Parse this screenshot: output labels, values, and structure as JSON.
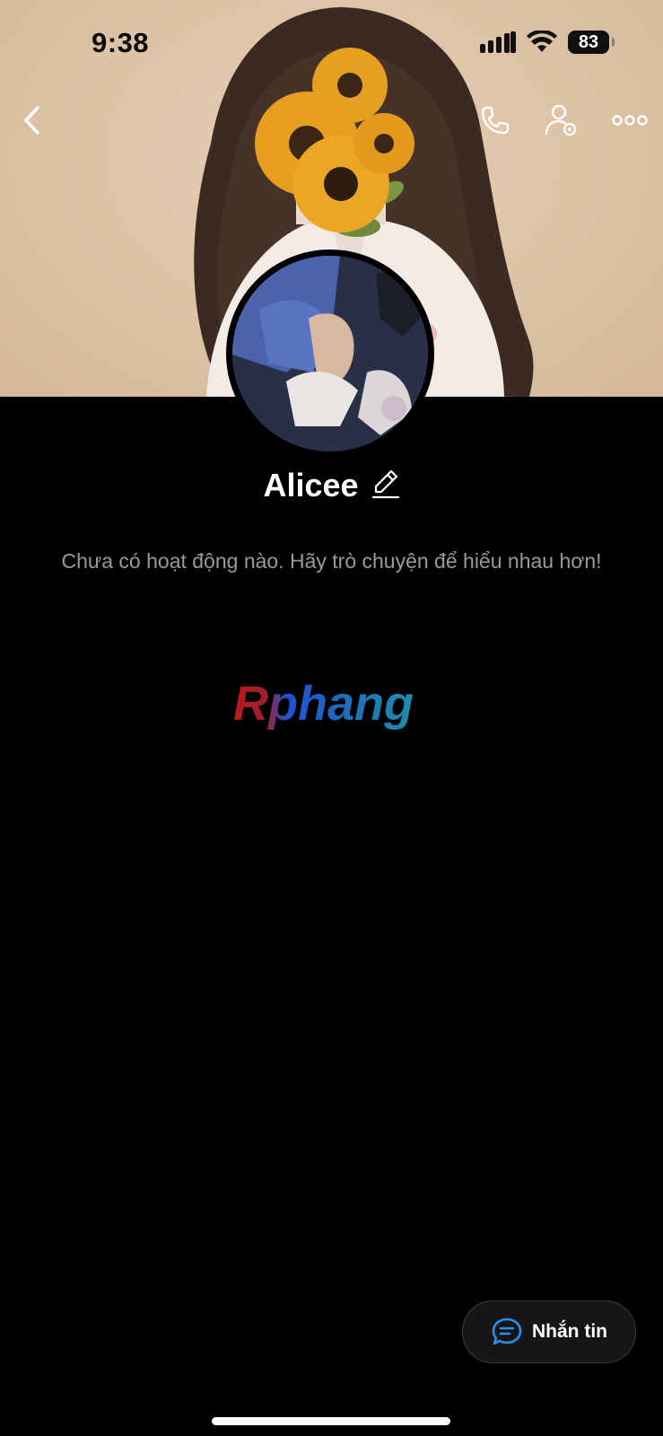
{
  "status_bar": {
    "time": "9:38",
    "battery": "83"
  },
  "profile": {
    "name": "Alicee",
    "activity_text": "Chưa có hoạt động nào. Hãy trò chuyện để hiểu nhau hơn!"
  },
  "watermark": {
    "text": "Rphang"
  },
  "actions": {
    "message_label": "Nhắn tin"
  },
  "icons": {
    "back": "chevron-left-icon",
    "call": "phone-icon",
    "settings": "user-settings-icon",
    "more": "more-icon",
    "edit": "pencil-icon",
    "message": "chat-bubble-icon"
  },
  "colors": {
    "accent": "#2e8cf0",
    "background": "#000000",
    "muted_text": "#9a9a9a"
  }
}
